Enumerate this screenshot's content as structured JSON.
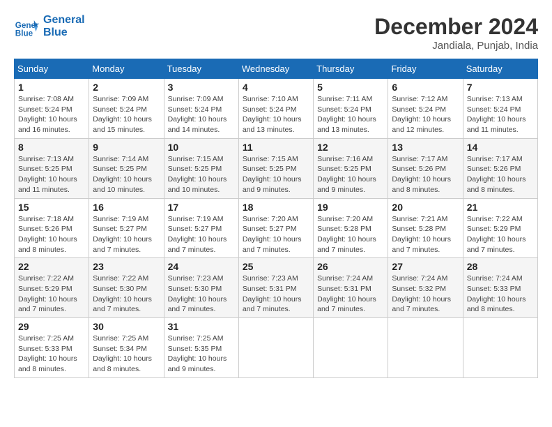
{
  "header": {
    "logo_line1": "General",
    "logo_line2": "Blue",
    "month": "December 2024",
    "location": "Jandiala, Punjab, India"
  },
  "weekdays": [
    "Sunday",
    "Monday",
    "Tuesday",
    "Wednesday",
    "Thursday",
    "Friday",
    "Saturday"
  ],
  "weeks": [
    [
      {
        "day": "1",
        "info": "Sunrise: 7:08 AM\nSunset: 5:24 PM\nDaylight: 10 hours\nand 16 minutes."
      },
      {
        "day": "2",
        "info": "Sunrise: 7:09 AM\nSunset: 5:24 PM\nDaylight: 10 hours\nand 15 minutes."
      },
      {
        "day": "3",
        "info": "Sunrise: 7:09 AM\nSunset: 5:24 PM\nDaylight: 10 hours\nand 14 minutes."
      },
      {
        "day": "4",
        "info": "Sunrise: 7:10 AM\nSunset: 5:24 PM\nDaylight: 10 hours\nand 13 minutes."
      },
      {
        "day": "5",
        "info": "Sunrise: 7:11 AM\nSunset: 5:24 PM\nDaylight: 10 hours\nand 13 minutes."
      },
      {
        "day": "6",
        "info": "Sunrise: 7:12 AM\nSunset: 5:24 PM\nDaylight: 10 hours\nand 12 minutes."
      },
      {
        "day": "7",
        "info": "Sunrise: 7:13 AM\nSunset: 5:24 PM\nDaylight: 10 hours\nand 11 minutes."
      }
    ],
    [
      {
        "day": "8",
        "info": "Sunrise: 7:13 AM\nSunset: 5:25 PM\nDaylight: 10 hours\nand 11 minutes."
      },
      {
        "day": "9",
        "info": "Sunrise: 7:14 AM\nSunset: 5:25 PM\nDaylight: 10 hours\nand 10 minutes."
      },
      {
        "day": "10",
        "info": "Sunrise: 7:15 AM\nSunset: 5:25 PM\nDaylight: 10 hours\nand 10 minutes."
      },
      {
        "day": "11",
        "info": "Sunrise: 7:15 AM\nSunset: 5:25 PM\nDaylight: 10 hours\nand 9 minutes."
      },
      {
        "day": "12",
        "info": "Sunrise: 7:16 AM\nSunset: 5:25 PM\nDaylight: 10 hours\nand 9 minutes."
      },
      {
        "day": "13",
        "info": "Sunrise: 7:17 AM\nSunset: 5:26 PM\nDaylight: 10 hours\nand 8 minutes."
      },
      {
        "day": "14",
        "info": "Sunrise: 7:17 AM\nSunset: 5:26 PM\nDaylight: 10 hours\nand 8 minutes."
      }
    ],
    [
      {
        "day": "15",
        "info": "Sunrise: 7:18 AM\nSunset: 5:26 PM\nDaylight: 10 hours\nand 8 minutes."
      },
      {
        "day": "16",
        "info": "Sunrise: 7:19 AM\nSunset: 5:27 PM\nDaylight: 10 hours\nand 7 minutes."
      },
      {
        "day": "17",
        "info": "Sunrise: 7:19 AM\nSunset: 5:27 PM\nDaylight: 10 hours\nand 7 minutes."
      },
      {
        "day": "18",
        "info": "Sunrise: 7:20 AM\nSunset: 5:27 PM\nDaylight: 10 hours\nand 7 minutes."
      },
      {
        "day": "19",
        "info": "Sunrise: 7:20 AM\nSunset: 5:28 PM\nDaylight: 10 hours\nand 7 minutes."
      },
      {
        "day": "20",
        "info": "Sunrise: 7:21 AM\nSunset: 5:28 PM\nDaylight: 10 hours\nand 7 minutes."
      },
      {
        "day": "21",
        "info": "Sunrise: 7:22 AM\nSunset: 5:29 PM\nDaylight: 10 hours\nand 7 minutes."
      }
    ],
    [
      {
        "day": "22",
        "info": "Sunrise: 7:22 AM\nSunset: 5:29 PM\nDaylight: 10 hours\nand 7 minutes."
      },
      {
        "day": "23",
        "info": "Sunrise: 7:22 AM\nSunset: 5:30 PM\nDaylight: 10 hours\nand 7 minutes."
      },
      {
        "day": "24",
        "info": "Sunrise: 7:23 AM\nSunset: 5:30 PM\nDaylight: 10 hours\nand 7 minutes."
      },
      {
        "day": "25",
        "info": "Sunrise: 7:23 AM\nSunset: 5:31 PM\nDaylight: 10 hours\nand 7 minutes."
      },
      {
        "day": "26",
        "info": "Sunrise: 7:24 AM\nSunset: 5:31 PM\nDaylight: 10 hours\nand 7 minutes."
      },
      {
        "day": "27",
        "info": "Sunrise: 7:24 AM\nSunset: 5:32 PM\nDaylight: 10 hours\nand 7 minutes."
      },
      {
        "day": "28",
        "info": "Sunrise: 7:24 AM\nSunset: 5:33 PM\nDaylight: 10 hours\nand 8 minutes."
      }
    ],
    [
      {
        "day": "29",
        "info": "Sunrise: 7:25 AM\nSunset: 5:33 PM\nDaylight: 10 hours\nand 8 minutes."
      },
      {
        "day": "30",
        "info": "Sunrise: 7:25 AM\nSunset: 5:34 PM\nDaylight: 10 hours\nand 8 minutes."
      },
      {
        "day": "31",
        "info": "Sunrise: 7:25 AM\nSunset: 5:35 PM\nDaylight: 10 hours\nand 9 minutes."
      },
      null,
      null,
      null,
      null
    ]
  ]
}
